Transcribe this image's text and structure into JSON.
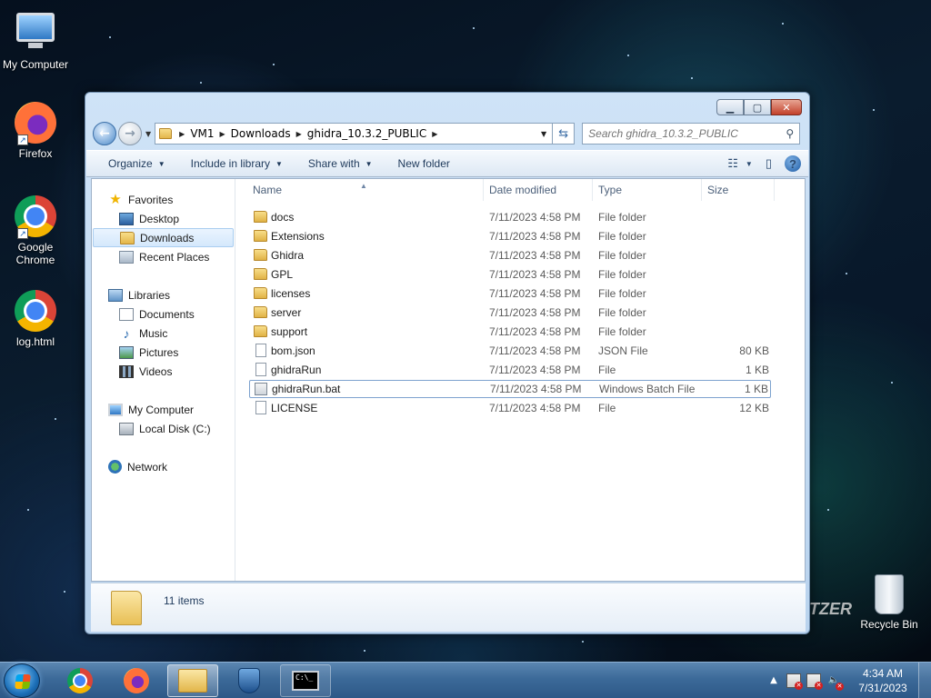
{
  "desktop": {
    "icons": [
      {
        "label": "My Computer"
      },
      {
        "label": "Firefox"
      },
      {
        "label": "Google Chrome"
      },
      {
        "label": "log.html"
      }
    ],
    "recycle_bin": "Recycle Bin",
    "wallpaper_text": "TZER"
  },
  "window": {
    "address": {
      "crumbs": [
        "VM1",
        "Downloads",
        "ghidra_10.3.2_PUBLIC"
      ]
    },
    "search": {
      "placeholder": "Search ghidra_10.3.2_PUBLIC"
    },
    "toolbar": {
      "organize": "Organize",
      "include_in_library": "Include in library",
      "share_with": "Share with",
      "new_folder": "New folder"
    },
    "nav_pane": {
      "favorites": "Favorites",
      "desktop": "Desktop",
      "downloads": "Downloads",
      "recent_places": "Recent Places",
      "libraries": "Libraries",
      "documents": "Documents",
      "music": "Music",
      "pictures": "Pictures",
      "videos": "Videos",
      "my_computer": "My Computer",
      "local_disk": "Local Disk (C:)",
      "network": "Network"
    },
    "columns": {
      "name": "Name",
      "date_modified": "Date modified",
      "type": "Type",
      "size": "Size"
    },
    "files": [
      {
        "name": "docs",
        "date": "7/11/2023 4:58 PM",
        "type": "File folder",
        "size": "",
        "kind": "folder"
      },
      {
        "name": "Extensions",
        "date": "7/11/2023 4:58 PM",
        "type": "File folder",
        "size": "",
        "kind": "folder"
      },
      {
        "name": "Ghidra",
        "date": "7/11/2023 4:58 PM",
        "type": "File folder",
        "size": "",
        "kind": "folder"
      },
      {
        "name": "GPL",
        "date": "7/11/2023 4:58 PM",
        "type": "File folder",
        "size": "",
        "kind": "folder"
      },
      {
        "name": "licenses",
        "date": "7/11/2023 4:58 PM",
        "type": "File folder",
        "size": "",
        "kind": "folder"
      },
      {
        "name": "server",
        "date": "7/11/2023 4:58 PM",
        "type": "File folder",
        "size": "",
        "kind": "folder"
      },
      {
        "name": "support",
        "date": "7/11/2023 4:58 PM",
        "type": "File folder",
        "size": "",
        "kind": "folder"
      },
      {
        "name": "bom.json",
        "date": "7/11/2023 4:58 PM",
        "type": "JSON File",
        "size": "80 KB",
        "kind": "file"
      },
      {
        "name": "ghidraRun",
        "date": "7/11/2023 4:58 PM",
        "type": "File",
        "size": "1 KB",
        "kind": "file"
      },
      {
        "name": "ghidraRun.bat",
        "date": "7/11/2023 4:58 PM",
        "type": "Windows Batch File",
        "size": "1 KB",
        "kind": "bat"
      },
      {
        "name": "LICENSE",
        "date": "7/11/2023 4:58 PM",
        "type": "File",
        "size": "12 KB",
        "kind": "file"
      }
    ],
    "details": {
      "item_count": "11 items"
    }
  },
  "taskbar": {
    "clock": {
      "time": "4:34 AM",
      "date": "7/31/2023"
    },
    "cmd_text": "C:\\_"
  }
}
